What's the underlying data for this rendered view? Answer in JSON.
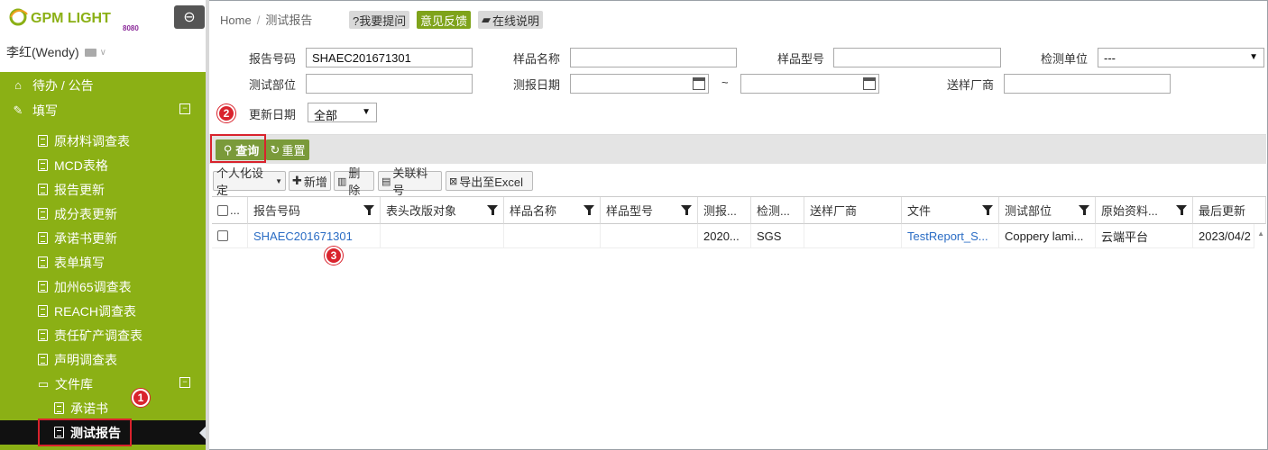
{
  "sidebar": {
    "logo_text": "GPM LIGHT",
    "logo_sub": "8080",
    "user_name": "李红(Wendy)",
    "nav": [
      {
        "label": "待办 / 公告",
        "icon": "home-icon"
      },
      {
        "label": "填写",
        "icon": "edit-icon",
        "toggle": "⊟"
      },
      {
        "label": "原材料调查表",
        "icon": "document-icon"
      },
      {
        "label": "MCD表格",
        "icon": "document-icon"
      },
      {
        "label": "报告更新",
        "icon": "document-icon"
      },
      {
        "label": "成分表更新",
        "icon": "document-icon"
      },
      {
        "label": "承诺书更新",
        "icon": "document-icon"
      },
      {
        "label": "表单填写",
        "icon": "document-icon"
      },
      {
        "label": "加州65调查表",
        "icon": "document-icon"
      },
      {
        "label": "REACH调查表",
        "icon": "document-icon"
      },
      {
        "label": "责任矿产调查表",
        "icon": "document-icon"
      },
      {
        "label": "声明调查表",
        "icon": "document-icon"
      },
      {
        "label": "文件库",
        "icon": "folder-icon",
        "toggle": "⊟"
      },
      {
        "label": "承诺书",
        "icon": "document-icon"
      },
      {
        "label": "测试报告",
        "icon": "document-icon"
      }
    ]
  },
  "breadcrumb": {
    "home": "Home",
    "sep": "/",
    "current": "测试报告"
  },
  "topbar": {
    "ask": "?我要提问",
    "feedback": "意见反馈",
    "help": "在线说明"
  },
  "filters": {
    "report_no_label": "报告号码",
    "report_no_value": "SHAEC201671301",
    "sample_name_label": "样品名称",
    "sample_name_value": "",
    "sample_model_label": "样品型号",
    "sample_model_value": "",
    "test_unit_label": "检测单位",
    "test_unit_value": "---",
    "test_part_label": "测试部位",
    "test_part_value": "",
    "report_date_label": "测报日期",
    "date_sep": "~",
    "supplier_label": "送样厂商",
    "supplier_value": "",
    "update_date_label": "更新日期",
    "update_date_value": "全部"
  },
  "actions": {
    "query": "查询",
    "reset": "重置"
  },
  "toolbar": {
    "personalize": "个人化设定",
    "add": "新增",
    "delete": "删除",
    "link": "关联料号",
    "export": "导出至Excel"
  },
  "grid": {
    "columns": [
      "☐...",
      "报告号码",
      "表头改版对象",
      "样品名称",
      "样品型号",
      "测报...",
      "检测...",
      "送样厂商",
      "文件",
      "测试部位",
      "原始资料...",
      "最后更新"
    ],
    "row": [
      "",
      "SHAEC201671301",
      "",
      "",
      "",
      "2020...",
      "SGS",
      "",
      "TestReport_S...",
      "Coppery lami...",
      "云端平台",
      "2023/04/2"
    ]
  },
  "badges": [
    "1",
    "2",
    "3"
  ],
  "colors": {
    "sidebar_green": "#8bb015",
    "button_green": "#7a9a3a",
    "highlight_red": "#d9232d",
    "link_blue": "#2a6cc4"
  }
}
